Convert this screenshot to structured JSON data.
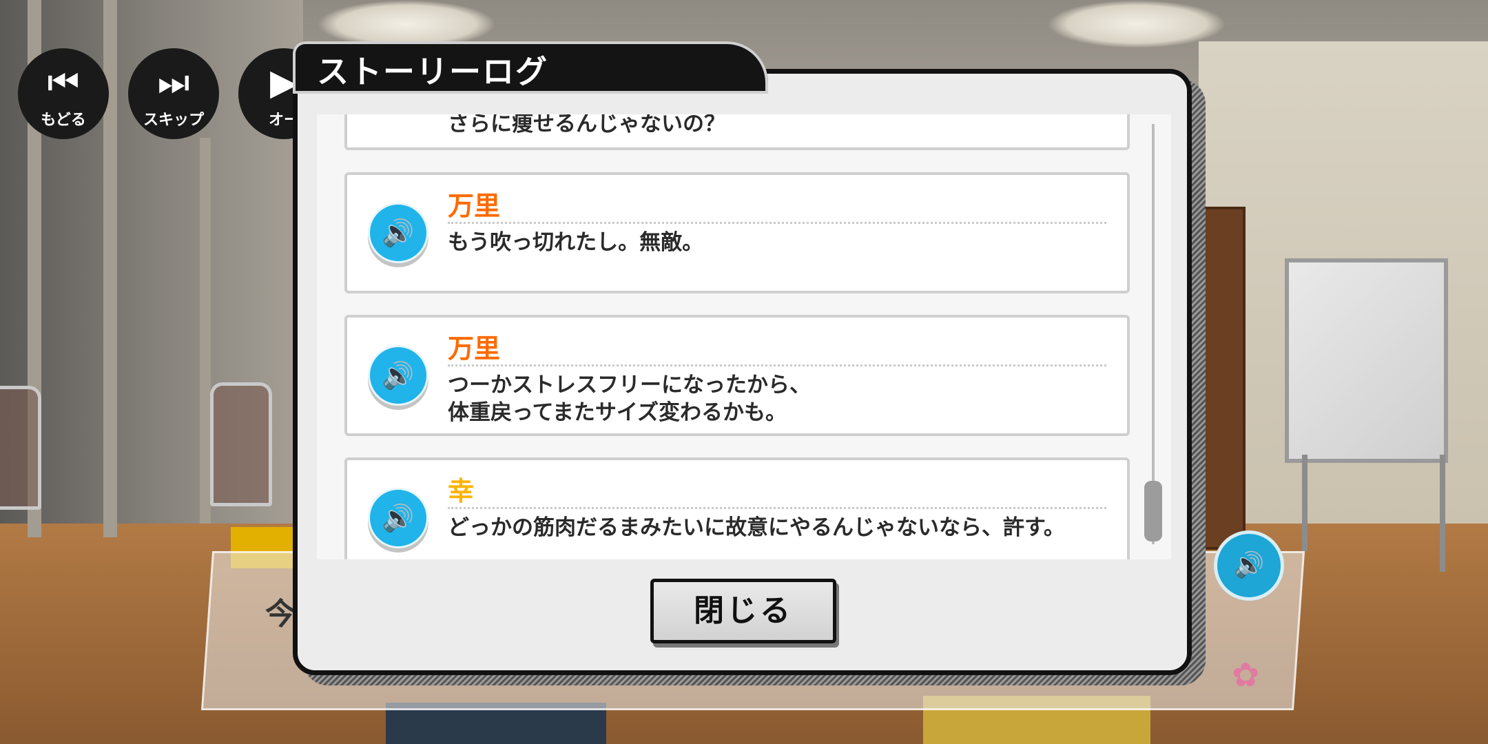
{
  "controls": [
    {
      "label": "もどる",
      "icon": "rewind-icon"
    },
    {
      "label": "スキップ",
      "icon": "skip-icon"
    },
    {
      "label": "オー",
      "icon": "auto-icon"
    }
  ],
  "background_dialogue": {
    "visible_text": "今"
  },
  "story_log": {
    "title": "ストーリーログ",
    "entries": [
      {
        "speaker": "",
        "lines": [
          "さらに痩せるんじゃないの？"
        ],
        "speaker_color": "#ff6a00"
      },
      {
        "speaker": "万里",
        "lines": [
          "もう吹っ切れたし。無敵。"
        ],
        "speaker_color": "#ff6a00"
      },
      {
        "speaker": "万里",
        "lines": [
          "つーかストレスフリーになったから、",
          "体重戻ってまたサイズ変わるかも。"
        ],
        "speaker_color": "#ff6a00"
      },
      {
        "speaker": "幸",
        "lines": [
          "どっかの筋肉だるまみたいに故意にやるんじゃないなら、許す。"
        ],
        "speaker_color": "#ffb300"
      }
    ],
    "close_label": "閉じる"
  },
  "colors": {
    "voice_button": "#20b4ea",
    "modal_border": "#111111"
  }
}
